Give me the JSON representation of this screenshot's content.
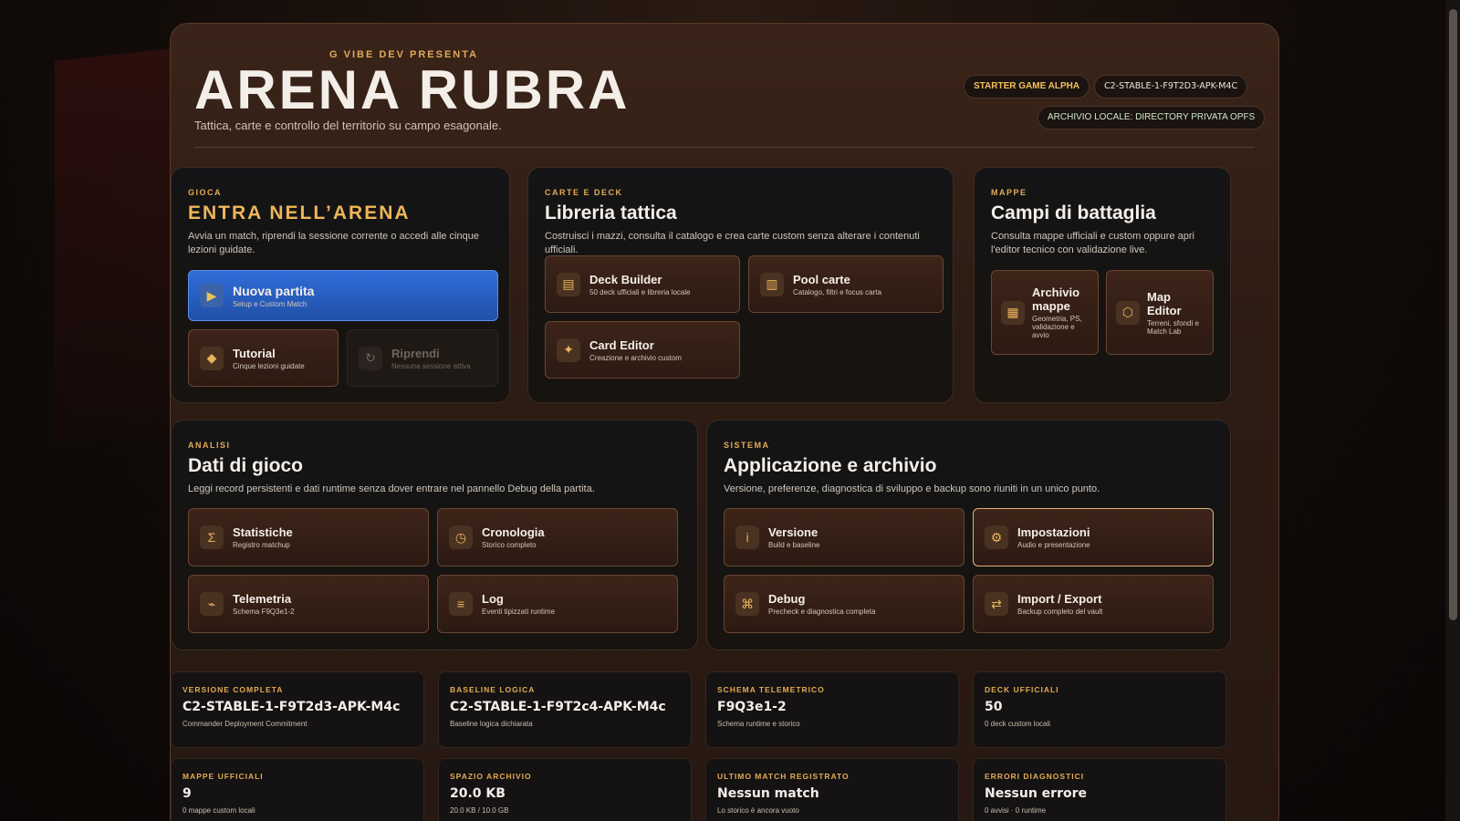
{
  "header": {
    "presenter": "G VIBE DEV PRESENTA",
    "title": "ARENA RUBRA",
    "subtitle": "Tattica, carte e controllo del territorio su campo esagonale.",
    "badges": {
      "edition": "STARTER GAME ALPHA",
      "build": "C2-STABLE-1-F9T2D3-APK-M4C",
      "archive": "ARCHIVIO LOCALE: DIRECTORY PRIVATA OPFS"
    }
  },
  "play": {
    "eyebrow": "GIOCA",
    "title": "ENTRA NELL’ARENA",
    "desc": "Avvia un match, riprendi la sessione corrente o accedi alle cinque lezioni guidate.",
    "new_match": {
      "label": "Nuova partita",
      "sub": "Setup e Custom Match",
      "icon": "play-icon"
    },
    "tutorial": {
      "label": "Tutorial",
      "sub": "Cinque lezioni guidate",
      "icon": "diamond-icon"
    },
    "resume": {
      "label": "Riprendi",
      "sub": "Nessuna sessione attiva",
      "icon": "refresh-icon"
    }
  },
  "cards": {
    "eyebrow": "CARTE E DECK",
    "title": "Libreria tattica",
    "desc": "Costruisci i mazzi, consulta il catalogo e crea carte custom senza alterare i contenuti ufficiali.",
    "deck_builder": {
      "label": "Deck Builder",
      "sub": "50 deck ufficiali e libreria locale"
    },
    "pool": {
      "label": "Pool carte",
      "sub": "Catalogo, filtri e focus carta"
    },
    "card_editor": {
      "label": "Card Editor",
      "sub": "Creazione e archivio custom"
    }
  },
  "maps": {
    "eyebrow": "MAPPE",
    "title": "Campi di battaglia",
    "desc": "Consulta mappe ufficiali e custom oppure apri l'editor tecnico con validazione live.",
    "archive": {
      "label": "Archivio mappe",
      "sub": "Geometria, PS, validazione e avvio"
    },
    "editor": {
      "label": "Map Editor",
      "sub": "Terreni, sfondi e Match Lab"
    }
  },
  "analysis": {
    "eyebrow": "ANALISI",
    "title": "Dati di gioco",
    "desc": "Leggi record persistenti e dati runtime senza dover entrare nel pannello Debug della partita.",
    "stats": {
      "label": "Statistiche",
      "sub": "Registro matchup"
    },
    "history": {
      "label": "Cronologia",
      "sub": "Storico completo"
    },
    "telemetry": {
      "label": "Telemetria",
      "sub": "Schema F9Q3e1-2"
    },
    "log": {
      "label": "Log",
      "sub": "Eventi tipizzati runtime"
    }
  },
  "system": {
    "eyebrow": "SISTEMA",
    "title": "Applicazione e archivio",
    "desc": "Versione, preferenze, diagnostica di sviluppo e backup sono riuniti in un unico punto.",
    "version": {
      "label": "Versione",
      "sub": "Build e baseline"
    },
    "settings": {
      "label": "Impostazioni",
      "sub": "Audio e presentazione"
    },
    "debug": {
      "label": "Debug",
      "sub": "Precheck e diagnostica completa"
    },
    "import_export": {
      "label": "Import / Export",
      "sub": "Backup completo del vault"
    }
  },
  "stats": [
    {
      "k": "VERSIONE COMPLETA",
      "v": "C2-STABLE-1-F9T2d3-APK-M4c",
      "s": "Commander Deployment Commitment"
    },
    {
      "k": "BASELINE LOGICA",
      "v": "C2-STABLE-1-F9T2c4-APK-M4c",
      "s": "Baseline logica dichiarata"
    },
    {
      "k": "SCHEMA TELEMETRICO",
      "v": "F9Q3e1-2",
      "s": "Schema runtime e storico"
    },
    {
      "k": "DECK UFFICIALI",
      "v": "50",
      "s": "0 deck custom locali"
    },
    {
      "k": "MAPPE UFFICIALI",
      "v": "9",
      "s": "0 mappe custom locali"
    },
    {
      "k": "SPAZIO ARCHIVIO",
      "v": "20.0 KB",
      "s": "20.0 KB / 10.0 GB"
    },
    {
      "k": "ULTIMO MATCH REGISTRATO",
      "v": "Nessun match",
      "s": "Lo storico è ancora vuoto"
    },
    {
      "k": "ERRORI DIAGNOSTICI",
      "v": "Nessun errore",
      "s": "0 avvisi · 0 runtime"
    }
  ],
  "colors": {
    "accent_gold": "#e3ab54",
    "primary_blue": "#2f6dd8",
    "panel_bg": "#141416"
  }
}
